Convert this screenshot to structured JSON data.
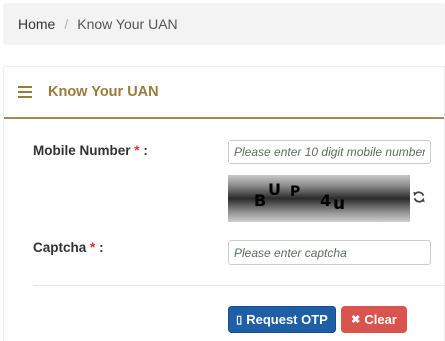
{
  "breadcrumb": {
    "home": "Home",
    "separator": "/",
    "current": "Know Your UAN"
  },
  "panel": {
    "title": "Know Your UAN",
    "accent_color": "#9a7b3c"
  },
  "form": {
    "mobile": {
      "label": "Mobile Number",
      "required_mark": "*",
      "colon": ":",
      "placeholder": "Please enter 10 digit mobile number",
      "value": ""
    },
    "captcha_image": {
      "chars": [
        "B",
        "U",
        "P",
        "4",
        "u"
      ]
    },
    "captcha": {
      "label": "Captcha",
      "required_mark": "*",
      "colon": ":",
      "placeholder": "Please enter captcha",
      "value": ""
    }
  },
  "buttons": {
    "request_otp": {
      "icon": "mobile-icon",
      "icon_glyph": "▯",
      "label": "Request OTP",
      "color": "#1f5fa6"
    },
    "clear": {
      "icon": "times-icon",
      "icon_glyph": "✖",
      "label": "Clear",
      "color": "#d9534f"
    }
  }
}
